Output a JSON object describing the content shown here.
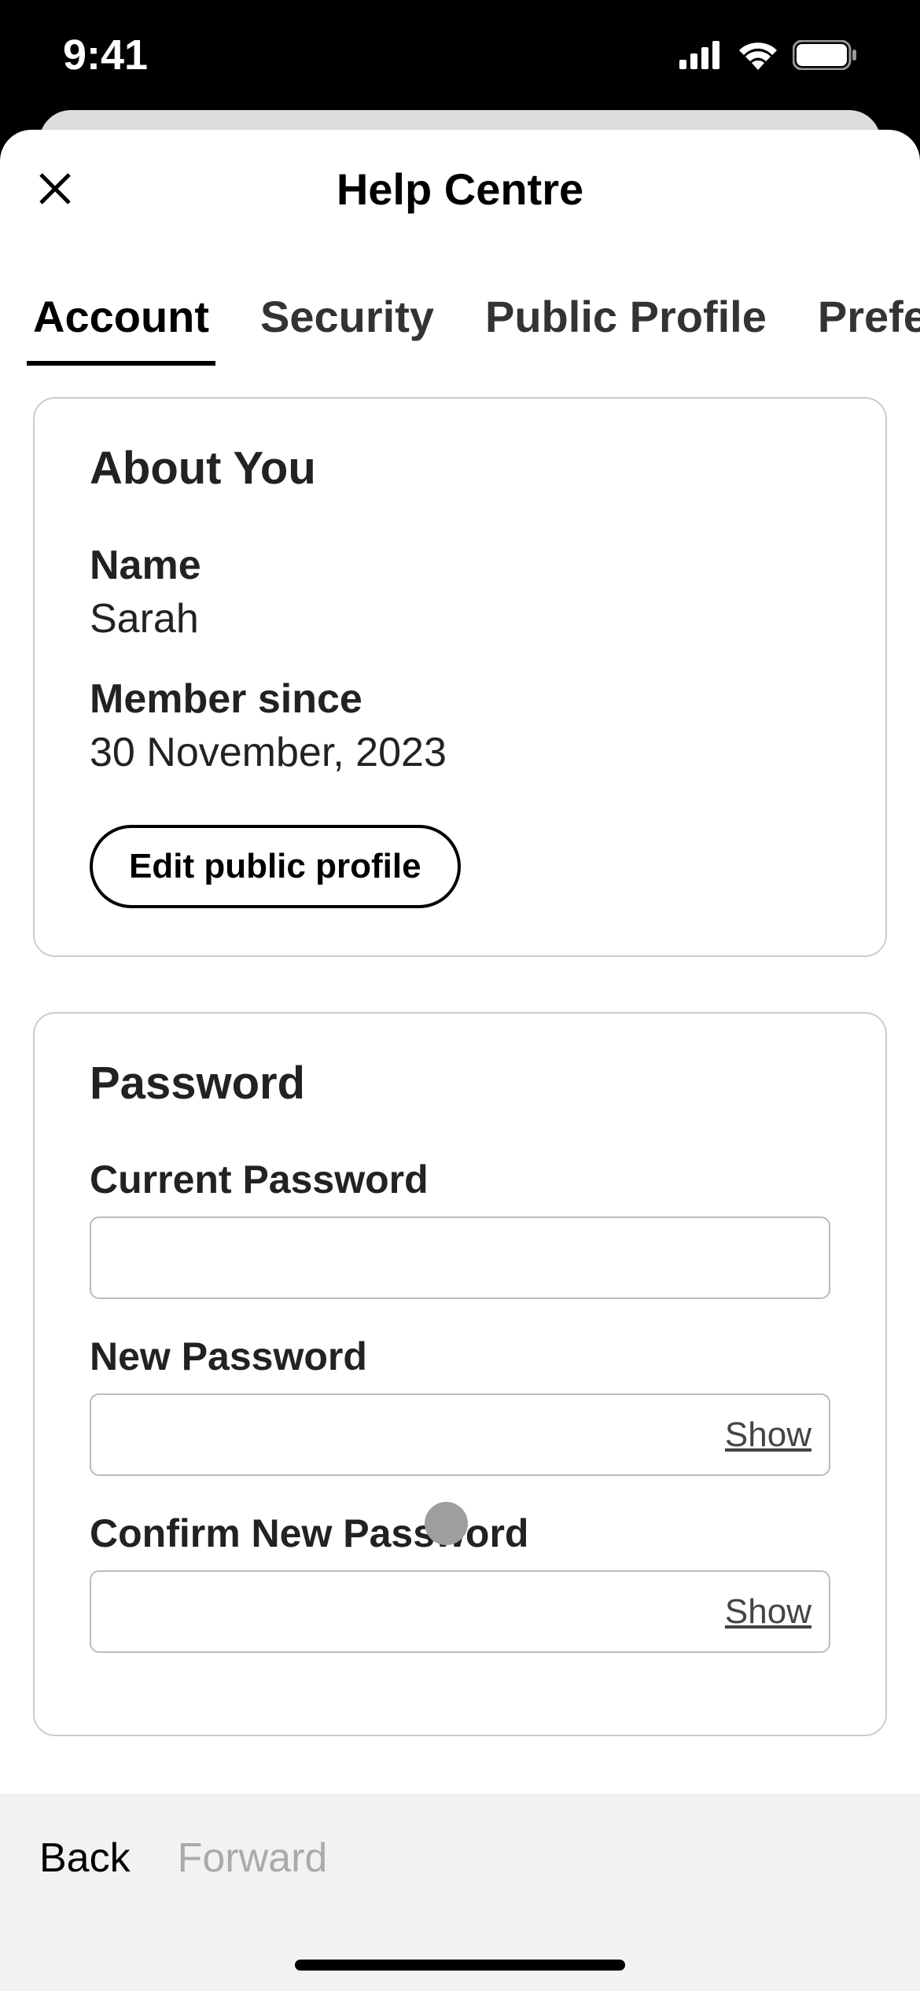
{
  "status": {
    "time": "9:41"
  },
  "header": {
    "title": "Help Centre"
  },
  "tabs": [
    {
      "label": "Account",
      "active": true
    },
    {
      "label": "Security",
      "active": false
    },
    {
      "label": "Public Profile",
      "active": false
    },
    {
      "label": "Preferences",
      "active": false
    }
  ],
  "about": {
    "title": "About You",
    "name_label": "Name",
    "name_value": "Sarah",
    "member_label": "Member since",
    "member_value": "30 November, 2023",
    "edit_button": "Edit public profile"
  },
  "password": {
    "title": "Password",
    "current_label": "Current Password",
    "new_label": "New Password",
    "confirm_label": "Confirm New Password",
    "show_label": "Show"
  },
  "nav": {
    "back": "Back",
    "forward": "Forward"
  }
}
